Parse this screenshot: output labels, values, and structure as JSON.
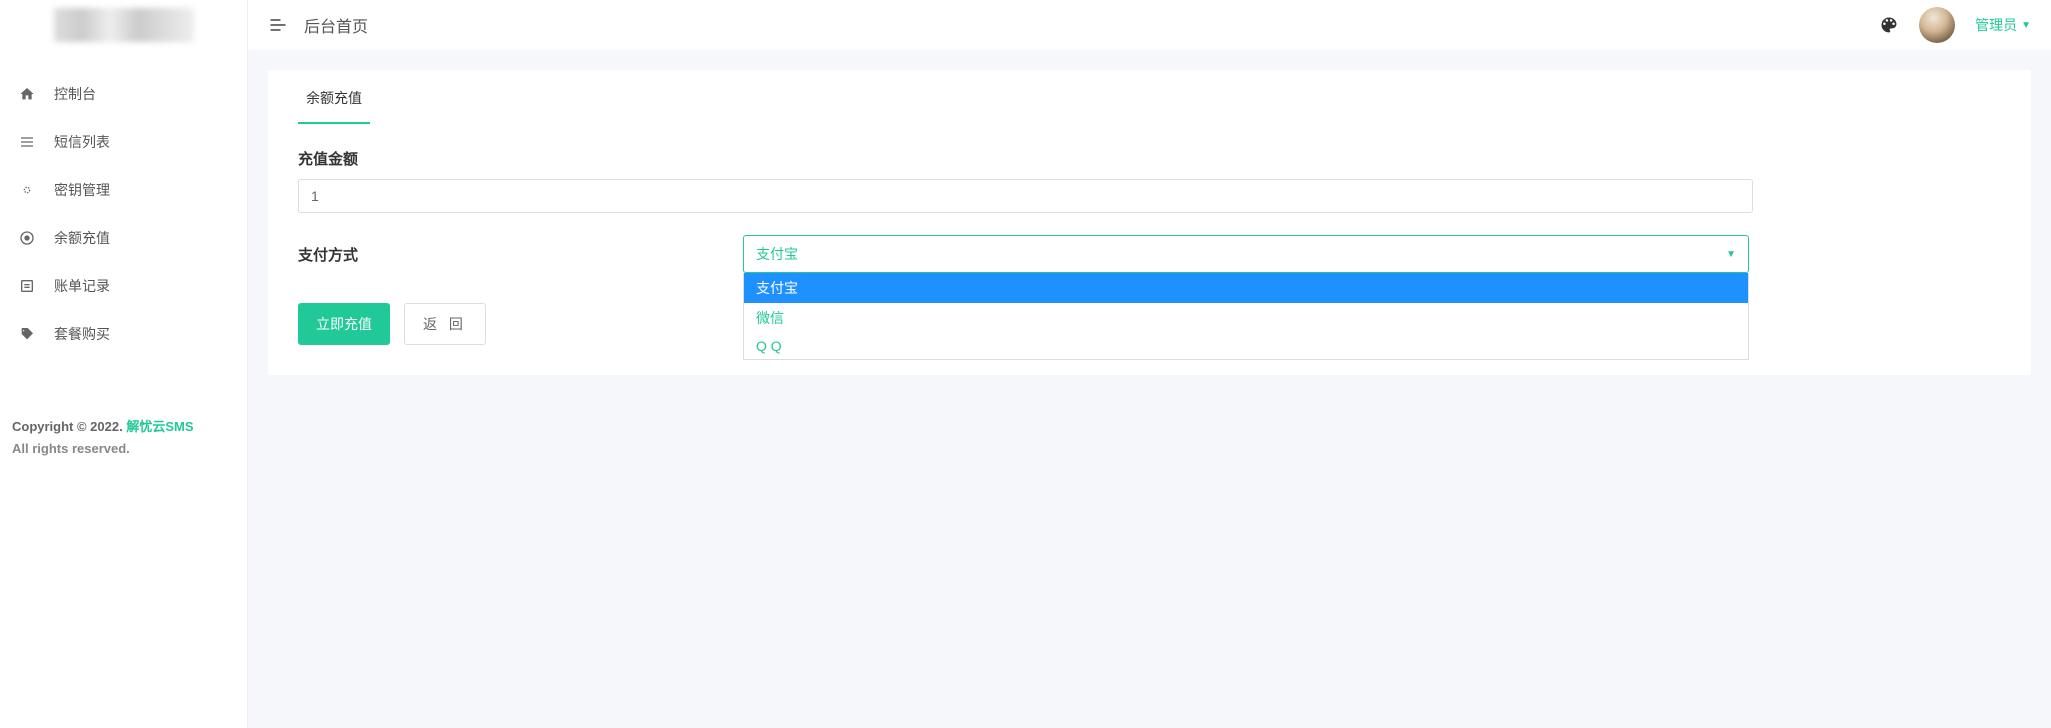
{
  "header": {
    "breadcrumb": "后台首页",
    "user_label": "管理员"
  },
  "sidebar": {
    "items": [
      {
        "label": "控制台",
        "icon": "home-icon"
      },
      {
        "label": "短信列表",
        "icon": "list-icon"
      },
      {
        "label": "密钥管理",
        "icon": "key-icon"
      },
      {
        "label": "余额充值",
        "icon": "coin-icon"
      },
      {
        "label": "账单记录",
        "icon": "bill-icon"
      },
      {
        "label": "套餐购买",
        "icon": "tag-icon"
      }
    ],
    "footer": {
      "copyright_prefix": "Copyright © 2022. ",
      "link_text": "解忧云SMS",
      "rights": "All rights reserved."
    }
  },
  "tabs": [
    {
      "label": "余额充值"
    }
  ],
  "form": {
    "amount_label": "充值金额",
    "amount_value": "1",
    "method_label": "支付方式",
    "method_selected": "支付宝",
    "method_options": [
      "支付宝",
      "微信",
      "Q Q"
    ]
  },
  "actions": {
    "submit_label": "立即充值",
    "back_label": "返 回"
  }
}
